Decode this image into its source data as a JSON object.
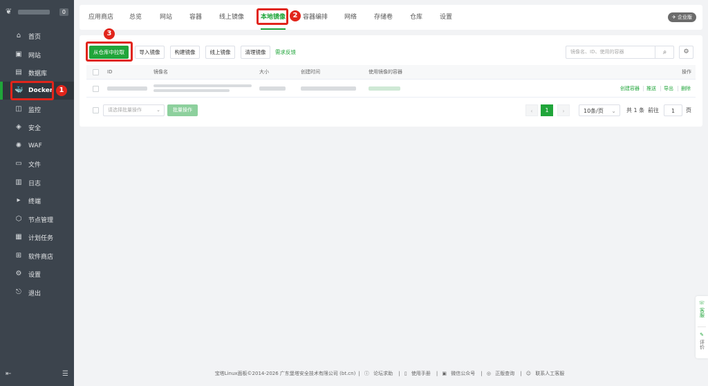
{
  "sidebar": {
    "server_badge": "0",
    "items": [
      {
        "label": "首页",
        "icon": "home-icon"
      },
      {
        "label": "网站",
        "icon": "globe-icon"
      },
      {
        "label": "数据库",
        "icon": "database-icon"
      },
      {
        "label": "Docker",
        "icon": "docker-icon"
      },
      {
        "label": "监控",
        "icon": "chart-icon"
      },
      {
        "label": "安全",
        "icon": "shield-icon"
      },
      {
        "label": "WAF",
        "icon": "waf-icon"
      },
      {
        "label": "文件",
        "icon": "folder-icon"
      },
      {
        "label": "日志",
        "icon": "log-icon"
      },
      {
        "label": "终端",
        "icon": "terminal-icon"
      },
      {
        "label": "节点管理",
        "icon": "node-icon"
      },
      {
        "label": "计划任务",
        "icon": "calendar-icon"
      },
      {
        "label": "软件商店",
        "icon": "store-icon"
      },
      {
        "label": "设置",
        "icon": "gear-icon"
      },
      {
        "label": "退出",
        "icon": "logout-icon"
      }
    ]
  },
  "annotations": {
    "one": "1",
    "two": "2",
    "three": "3"
  },
  "tabs": [
    "应用商店",
    "总览",
    "网站",
    "容器",
    "线上镜像",
    "本地镜像",
    "容器编排",
    "网络",
    "存储卷",
    "仓库",
    "设置"
  ],
  "enterprise_label": "企业版",
  "toolbar": {
    "pull_button": "从仓库中拉取",
    "import_button": "导入镜像",
    "build_button": "构建镜像",
    "online_button": "线上镜像",
    "clean_button": "清理镜像",
    "feedback_link": "需求反馈",
    "search_placeholder": "镜像名、ID、使用的容器"
  },
  "table": {
    "headers": {
      "id": "ID",
      "name": "镜像名",
      "size": "大小",
      "created": "创建时间",
      "containers": "使用镜像的容器",
      "actions": "操作"
    },
    "row_actions": [
      "创建容器",
      "推送",
      "导出",
      "删除"
    ]
  },
  "batch": {
    "select_placeholder": "请选择批量操作",
    "batch_button": "批量操作"
  },
  "pagination": {
    "current": "1",
    "page_size": "10条/页",
    "total": "共 1 条",
    "goto_label": "前往",
    "goto_value": "1",
    "page_suffix": "页"
  },
  "footer": {
    "copyright": "宝塔Linux面板©2014-2026 广东堡塔安全技术有限公司 (bt.cn)",
    "links": [
      "论坛求助",
      "使用手册",
      "微信公众号",
      "正版查询",
      "联系人工客服"
    ]
  },
  "float": {
    "service": "客服",
    "review": "评价"
  },
  "colors": {
    "accent": "#20a53a",
    "sidebar_bg": "#3c444d",
    "annotation_red": "#e1251b"
  }
}
